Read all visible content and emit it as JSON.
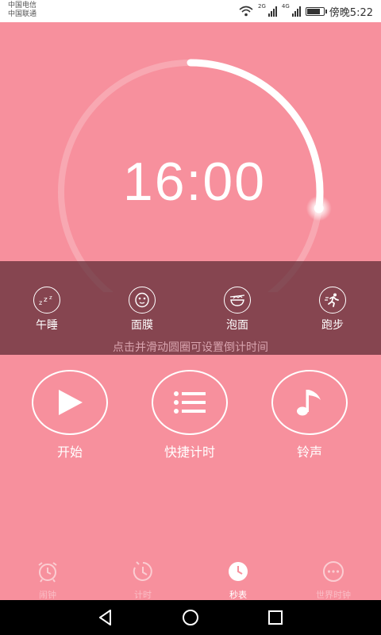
{
  "status_bar": {
    "carrier_1": "中国电信",
    "carrier_2": "中国联通",
    "net_1": "2G",
    "net_2": "4G",
    "battery_level": 0.85,
    "time": "傍晚5:22"
  },
  "timer": {
    "display": "16:00",
    "arc_fraction": 0.27
  },
  "quick_presets": [
    {
      "label": "午睡",
      "icon": "sleep-icon"
    },
    {
      "label": "面膜",
      "icon": "face-mask-icon"
    },
    {
      "label": "泡面",
      "icon": "noodle-bowl-icon"
    },
    {
      "label": "跑步",
      "icon": "running-icon"
    }
  ],
  "hint": "点击并滑动圆圈可设置倒计时间",
  "actions": {
    "start": "开始",
    "quick_timer": "快捷计时",
    "ringtone": "铃声"
  },
  "tabs": [
    {
      "label": "闹钟",
      "icon": "alarm-clock-icon",
      "active": false
    },
    {
      "label": "计时",
      "icon": "timer-icon",
      "active": false
    },
    {
      "label": "秒表",
      "icon": "stopwatch-icon",
      "active": true
    },
    {
      "label": "世界时钟",
      "icon": "world-clock-icon",
      "active": false
    }
  ],
  "colors": {
    "background": "#f7909d",
    "overlay": "#5a2832",
    "white": "#ffffff"
  }
}
